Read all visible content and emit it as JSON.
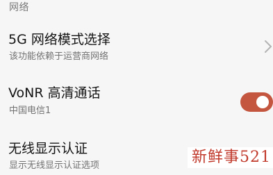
{
  "section": {
    "header": "网络"
  },
  "settings": [
    {
      "title": "5G 网络模式选择",
      "subtitle": "该功能依赖于运营商网络",
      "control": "chevron-right-icon"
    },
    {
      "title": "VoNR 高清通话",
      "subtitle": "中国电信1",
      "control": "toggle",
      "toggle_on": true
    },
    {
      "title": "无线显示认证",
      "subtitle": "显示无线显示认证选项",
      "control": "none"
    }
  ],
  "watermark": {
    "text": "新鲜事521"
  },
  "colors": {
    "toggle_on": "#c4563f",
    "watermark": "#c0392b",
    "background": "#f6f6f6"
  }
}
